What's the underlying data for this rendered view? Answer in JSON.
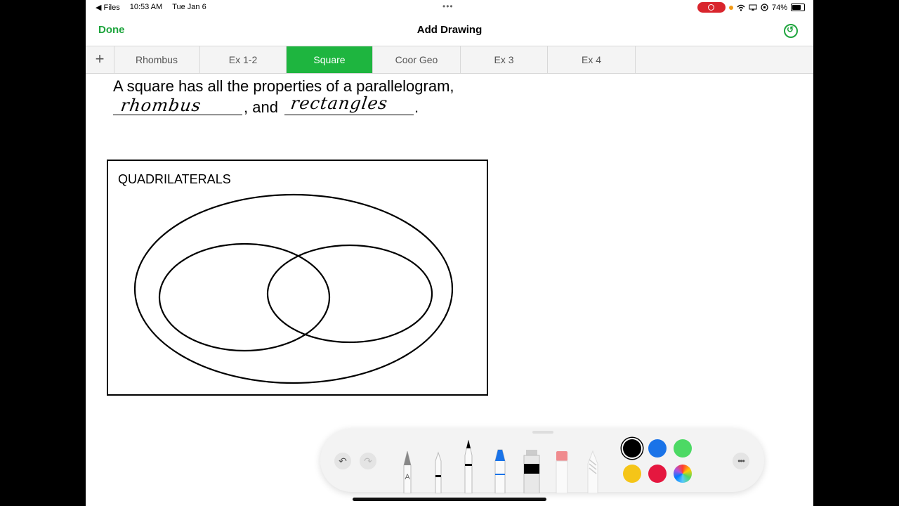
{
  "status_bar": {
    "back_app": "Files",
    "time": "10:53 AM",
    "date": "Tue Jan 6",
    "battery": "74%"
  },
  "nav": {
    "done_label": "Done",
    "title": "Add Drawing"
  },
  "tabs": [
    {
      "label": "Rhombus",
      "active": false
    },
    {
      "label": "Ex 1-2",
      "active": false
    },
    {
      "label": "Square",
      "active": true
    },
    {
      "label": "Coor Geo",
      "active": false
    },
    {
      "label": "Ex 3",
      "active": false
    },
    {
      "label": "Ex 4",
      "active": false
    }
  ],
  "document": {
    "sentence_line1": "A square has all the properties of a parallelogram,",
    "sentence_and": ", and",
    "sentence_period": ".",
    "handwritten_answer_1": "rhombus",
    "handwritten_answer_2": "rectangles",
    "venn_title": "QUADRILATERALS"
  },
  "toolbar": {
    "pen_letter": "A",
    "colors": [
      "#000000",
      "#1a73e8",
      "#4cd964",
      "#f5c518",
      "#e5173f"
    ],
    "selected_color": "#000000"
  }
}
